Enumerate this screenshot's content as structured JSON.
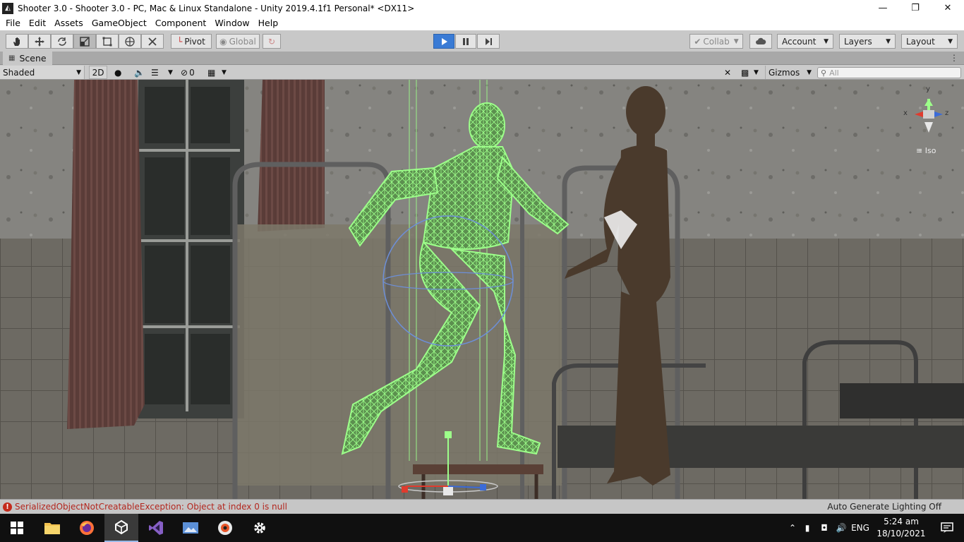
{
  "window": {
    "title": "Shooter 3.0 - Shooter 3.0 - PC, Mac & Linux Standalone - Unity 2019.4.1f1 Personal* <DX11>",
    "controls": [
      "minimize",
      "maximize",
      "close"
    ]
  },
  "menu": [
    "File",
    "Edit",
    "Assets",
    "GameObject",
    "Component",
    "Window",
    "Help"
  ],
  "toolbar": {
    "pivot_label": "Pivot",
    "global_label": "Global",
    "collab_label": "Collab",
    "account_label": "Account",
    "layers_label": "Layers",
    "layout_label": "Layout",
    "play_state": "playing"
  },
  "scene_tab": {
    "label": "Scene"
  },
  "scene_toolbar": {
    "shading_mode": "Shaded",
    "mode_2d": "2D",
    "hidden_count": "0",
    "gizmos_label": "Gizmos",
    "search_placeholder": "All"
  },
  "orientation_gizmo": {
    "y_label": "y",
    "x_label": "x",
    "z_label": "z",
    "projection_label": "Iso"
  },
  "status": {
    "error_text": "SerializedObjectNotCreatableException: Object at index 0 is null",
    "lighting_text": "Auto Generate Lighting Off"
  },
  "taskbar": {
    "apps": [
      "windows-start",
      "file-explorer",
      "firefox",
      "unity",
      "visual-studio",
      "photos",
      "media-app",
      "settings"
    ],
    "language": "ENG",
    "time": "5:24 am",
    "date": "18/10/2021"
  },
  "colors": {
    "accent_play": "#3a7bd5",
    "wireframe": "#7bff6a",
    "error": "#c42b1c"
  }
}
